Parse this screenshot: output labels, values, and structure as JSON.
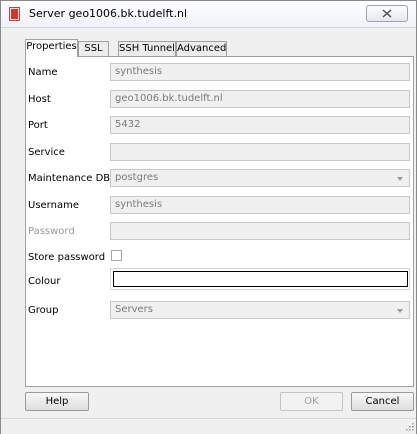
{
  "window": {
    "title": "Server geo1006.bk.tudelft.nl"
  },
  "tabs": [
    {
      "label": "Properties",
      "active": true
    },
    {
      "label": "SSL",
      "active": false
    },
    {
      "label": "SSH Tunnel",
      "active": false
    },
    {
      "label": "Advanced",
      "active": false
    }
  ],
  "form": {
    "name": {
      "label": "Name",
      "value": "synthesis"
    },
    "host": {
      "label": "Host",
      "value": "geo1006.bk.tudelft.nl"
    },
    "port": {
      "label": "Port",
      "value": "5432"
    },
    "service": {
      "label": "Service",
      "value": ""
    },
    "maintenance_db": {
      "label": "Maintenance DB",
      "value": "postgres"
    },
    "username": {
      "label": "Username",
      "value": "synthesis"
    },
    "password": {
      "label": "Password",
      "value": ""
    },
    "store_password": {
      "label": "Store password",
      "checked": false
    },
    "colour": {
      "label": "Colour",
      "value": ""
    },
    "group": {
      "label": "Group",
      "value": "Servers"
    }
  },
  "buttons": {
    "help": "Help",
    "ok": "OK",
    "cancel": "Cancel"
  },
  "icons": {
    "title": "database-server-icon",
    "close": "close-icon",
    "grip": "resize-grip-icon"
  },
  "colors": {
    "title_icon": "#d9342b",
    "disabled_text": "#9a9a9a"
  }
}
